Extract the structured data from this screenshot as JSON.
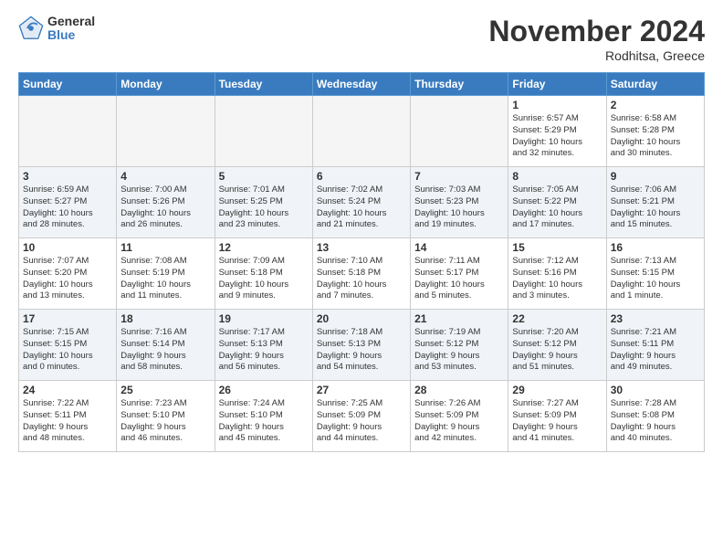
{
  "header": {
    "logo_general": "General",
    "logo_blue": "Blue",
    "month_title": "November 2024",
    "location": "Rodhitsa, Greece"
  },
  "days_of_week": [
    "Sunday",
    "Monday",
    "Tuesday",
    "Wednesday",
    "Thursday",
    "Friday",
    "Saturday"
  ],
  "weeks": [
    [
      {
        "day": "",
        "info": ""
      },
      {
        "day": "",
        "info": ""
      },
      {
        "day": "",
        "info": ""
      },
      {
        "day": "",
        "info": ""
      },
      {
        "day": "",
        "info": ""
      },
      {
        "day": "1",
        "info": "Sunrise: 6:57 AM\nSunset: 5:29 PM\nDaylight: 10 hours\nand 32 minutes."
      },
      {
        "day": "2",
        "info": "Sunrise: 6:58 AM\nSunset: 5:28 PM\nDaylight: 10 hours\nand 30 minutes."
      }
    ],
    [
      {
        "day": "3",
        "info": "Sunrise: 6:59 AM\nSunset: 5:27 PM\nDaylight: 10 hours\nand 28 minutes."
      },
      {
        "day": "4",
        "info": "Sunrise: 7:00 AM\nSunset: 5:26 PM\nDaylight: 10 hours\nand 26 minutes."
      },
      {
        "day": "5",
        "info": "Sunrise: 7:01 AM\nSunset: 5:25 PM\nDaylight: 10 hours\nand 23 minutes."
      },
      {
        "day": "6",
        "info": "Sunrise: 7:02 AM\nSunset: 5:24 PM\nDaylight: 10 hours\nand 21 minutes."
      },
      {
        "day": "7",
        "info": "Sunrise: 7:03 AM\nSunset: 5:23 PM\nDaylight: 10 hours\nand 19 minutes."
      },
      {
        "day": "8",
        "info": "Sunrise: 7:05 AM\nSunset: 5:22 PM\nDaylight: 10 hours\nand 17 minutes."
      },
      {
        "day": "9",
        "info": "Sunrise: 7:06 AM\nSunset: 5:21 PM\nDaylight: 10 hours\nand 15 minutes."
      }
    ],
    [
      {
        "day": "10",
        "info": "Sunrise: 7:07 AM\nSunset: 5:20 PM\nDaylight: 10 hours\nand 13 minutes."
      },
      {
        "day": "11",
        "info": "Sunrise: 7:08 AM\nSunset: 5:19 PM\nDaylight: 10 hours\nand 11 minutes."
      },
      {
        "day": "12",
        "info": "Sunrise: 7:09 AM\nSunset: 5:18 PM\nDaylight: 10 hours\nand 9 minutes."
      },
      {
        "day": "13",
        "info": "Sunrise: 7:10 AM\nSunset: 5:18 PM\nDaylight: 10 hours\nand 7 minutes."
      },
      {
        "day": "14",
        "info": "Sunrise: 7:11 AM\nSunset: 5:17 PM\nDaylight: 10 hours\nand 5 minutes."
      },
      {
        "day": "15",
        "info": "Sunrise: 7:12 AM\nSunset: 5:16 PM\nDaylight: 10 hours\nand 3 minutes."
      },
      {
        "day": "16",
        "info": "Sunrise: 7:13 AM\nSunset: 5:15 PM\nDaylight: 10 hours\nand 1 minute."
      }
    ],
    [
      {
        "day": "17",
        "info": "Sunrise: 7:15 AM\nSunset: 5:15 PM\nDaylight: 10 hours\nand 0 minutes."
      },
      {
        "day": "18",
        "info": "Sunrise: 7:16 AM\nSunset: 5:14 PM\nDaylight: 9 hours\nand 58 minutes."
      },
      {
        "day": "19",
        "info": "Sunrise: 7:17 AM\nSunset: 5:13 PM\nDaylight: 9 hours\nand 56 minutes."
      },
      {
        "day": "20",
        "info": "Sunrise: 7:18 AM\nSunset: 5:13 PM\nDaylight: 9 hours\nand 54 minutes."
      },
      {
        "day": "21",
        "info": "Sunrise: 7:19 AM\nSunset: 5:12 PM\nDaylight: 9 hours\nand 53 minutes."
      },
      {
        "day": "22",
        "info": "Sunrise: 7:20 AM\nSunset: 5:12 PM\nDaylight: 9 hours\nand 51 minutes."
      },
      {
        "day": "23",
        "info": "Sunrise: 7:21 AM\nSunset: 5:11 PM\nDaylight: 9 hours\nand 49 minutes."
      }
    ],
    [
      {
        "day": "24",
        "info": "Sunrise: 7:22 AM\nSunset: 5:11 PM\nDaylight: 9 hours\nand 48 minutes."
      },
      {
        "day": "25",
        "info": "Sunrise: 7:23 AM\nSunset: 5:10 PM\nDaylight: 9 hours\nand 46 minutes."
      },
      {
        "day": "26",
        "info": "Sunrise: 7:24 AM\nSunset: 5:10 PM\nDaylight: 9 hours\nand 45 minutes."
      },
      {
        "day": "27",
        "info": "Sunrise: 7:25 AM\nSunset: 5:09 PM\nDaylight: 9 hours\nand 44 minutes."
      },
      {
        "day": "28",
        "info": "Sunrise: 7:26 AM\nSunset: 5:09 PM\nDaylight: 9 hours\nand 42 minutes."
      },
      {
        "day": "29",
        "info": "Sunrise: 7:27 AM\nSunset: 5:09 PM\nDaylight: 9 hours\nand 41 minutes."
      },
      {
        "day": "30",
        "info": "Sunrise: 7:28 AM\nSunset: 5:08 PM\nDaylight: 9 hours\nand 40 minutes."
      }
    ]
  ]
}
